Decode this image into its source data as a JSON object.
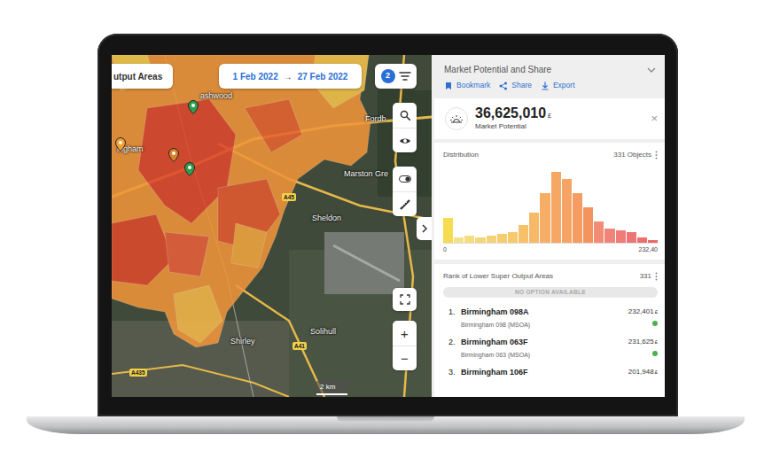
{
  "map": {
    "layer_pill": "utput Areas",
    "date_from": "1 Feb 2022",
    "date_arrow": "→",
    "date_to": "27 Feb 2022",
    "filter_badge": "2",
    "zoom_in": "+",
    "zoom_out": "−",
    "scale": "2 km",
    "labels": [
      {
        "text": "ashwood",
        "kind": "place"
      },
      {
        "text": "ingham",
        "kind": "place"
      },
      {
        "text": "Fordb",
        "kind": "place"
      },
      {
        "text": "Marston Gre",
        "kind": "place"
      },
      {
        "text": "Sheldon",
        "kind": "place"
      },
      {
        "text": "Shirley",
        "kind": "place"
      },
      {
        "text": "Solihull",
        "kind": "place"
      },
      {
        "text": "A45",
        "kind": "road"
      },
      {
        "text": "A41",
        "kind": "road"
      },
      {
        "text": "A435",
        "kind": "road"
      }
    ],
    "pins": [
      {
        "color": "#f0a030"
      },
      {
        "color": "#d9822b"
      },
      {
        "color": "#2e9e4f"
      },
      {
        "color": "#2e9e4f"
      }
    ]
  },
  "panel": {
    "title": "Market Potential and Share",
    "actions": [
      {
        "label": "Bookmark"
      },
      {
        "label": "Share"
      },
      {
        "label": "Export"
      }
    ],
    "kpi": {
      "value": "36,625,010",
      "unit": "£",
      "label": "Market Potential",
      "close": "×"
    },
    "distribution": {
      "title": "Distribution",
      "count": "331 Objects",
      "axis_min": "0",
      "axis_max": "232,40",
      "bars": [
        {
          "value": 28,
          "color": "#f5dc50"
        },
        {
          "value": 6,
          "color": "#f5e08a"
        },
        {
          "value": 8,
          "color": "#f5dc80"
        },
        {
          "value": 6,
          "color": "#f4d67a"
        },
        {
          "value": 8,
          "color": "#f4d27a"
        },
        {
          "value": 10,
          "color": "#f6cd6e"
        },
        {
          "value": 12,
          "color": "#f7c86c"
        },
        {
          "value": 20,
          "color": "#f7c16a"
        },
        {
          "value": 34,
          "color": "#f7b868"
        },
        {
          "value": 56,
          "color": "#f6ae66"
        },
        {
          "value": 80,
          "color": "#f5a866"
        },
        {
          "value": 72,
          "color": "#f5a466"
        },
        {
          "value": 56,
          "color": "#f49c62"
        },
        {
          "value": 40,
          "color": "#f3945e"
        },
        {
          "value": 24,
          "color": "#f28c76"
        },
        {
          "value": 16,
          "color": "#f18478"
        },
        {
          "value": 14,
          "color": "#f07c78"
        },
        {
          "value": 12,
          "color": "#ef7474"
        },
        {
          "value": 6,
          "color": "#ee6e6e"
        },
        {
          "value": 3,
          "color": "#ec6868"
        }
      ]
    },
    "rank": {
      "title": "Rank of Lower Super Output Areas",
      "count": "331",
      "filter": "NO OPTION AVAILABLE",
      "items": [
        {
          "rank": "1.",
          "name": "Birmingham 098A",
          "parent": "Birmingham 098 (MSOA)",
          "value": "232,401",
          "unit": "£",
          "color": "#4caf50"
        },
        {
          "rank": "2.",
          "name": "Birmingham 063F",
          "parent": "Birmingham 063 (MSOA)",
          "value": "231,625",
          "unit": "£",
          "color": "#4caf50"
        },
        {
          "rank": "3.",
          "name": "Birmingham 106F",
          "value": "201,948",
          "unit": "£"
        }
      ]
    }
  }
}
